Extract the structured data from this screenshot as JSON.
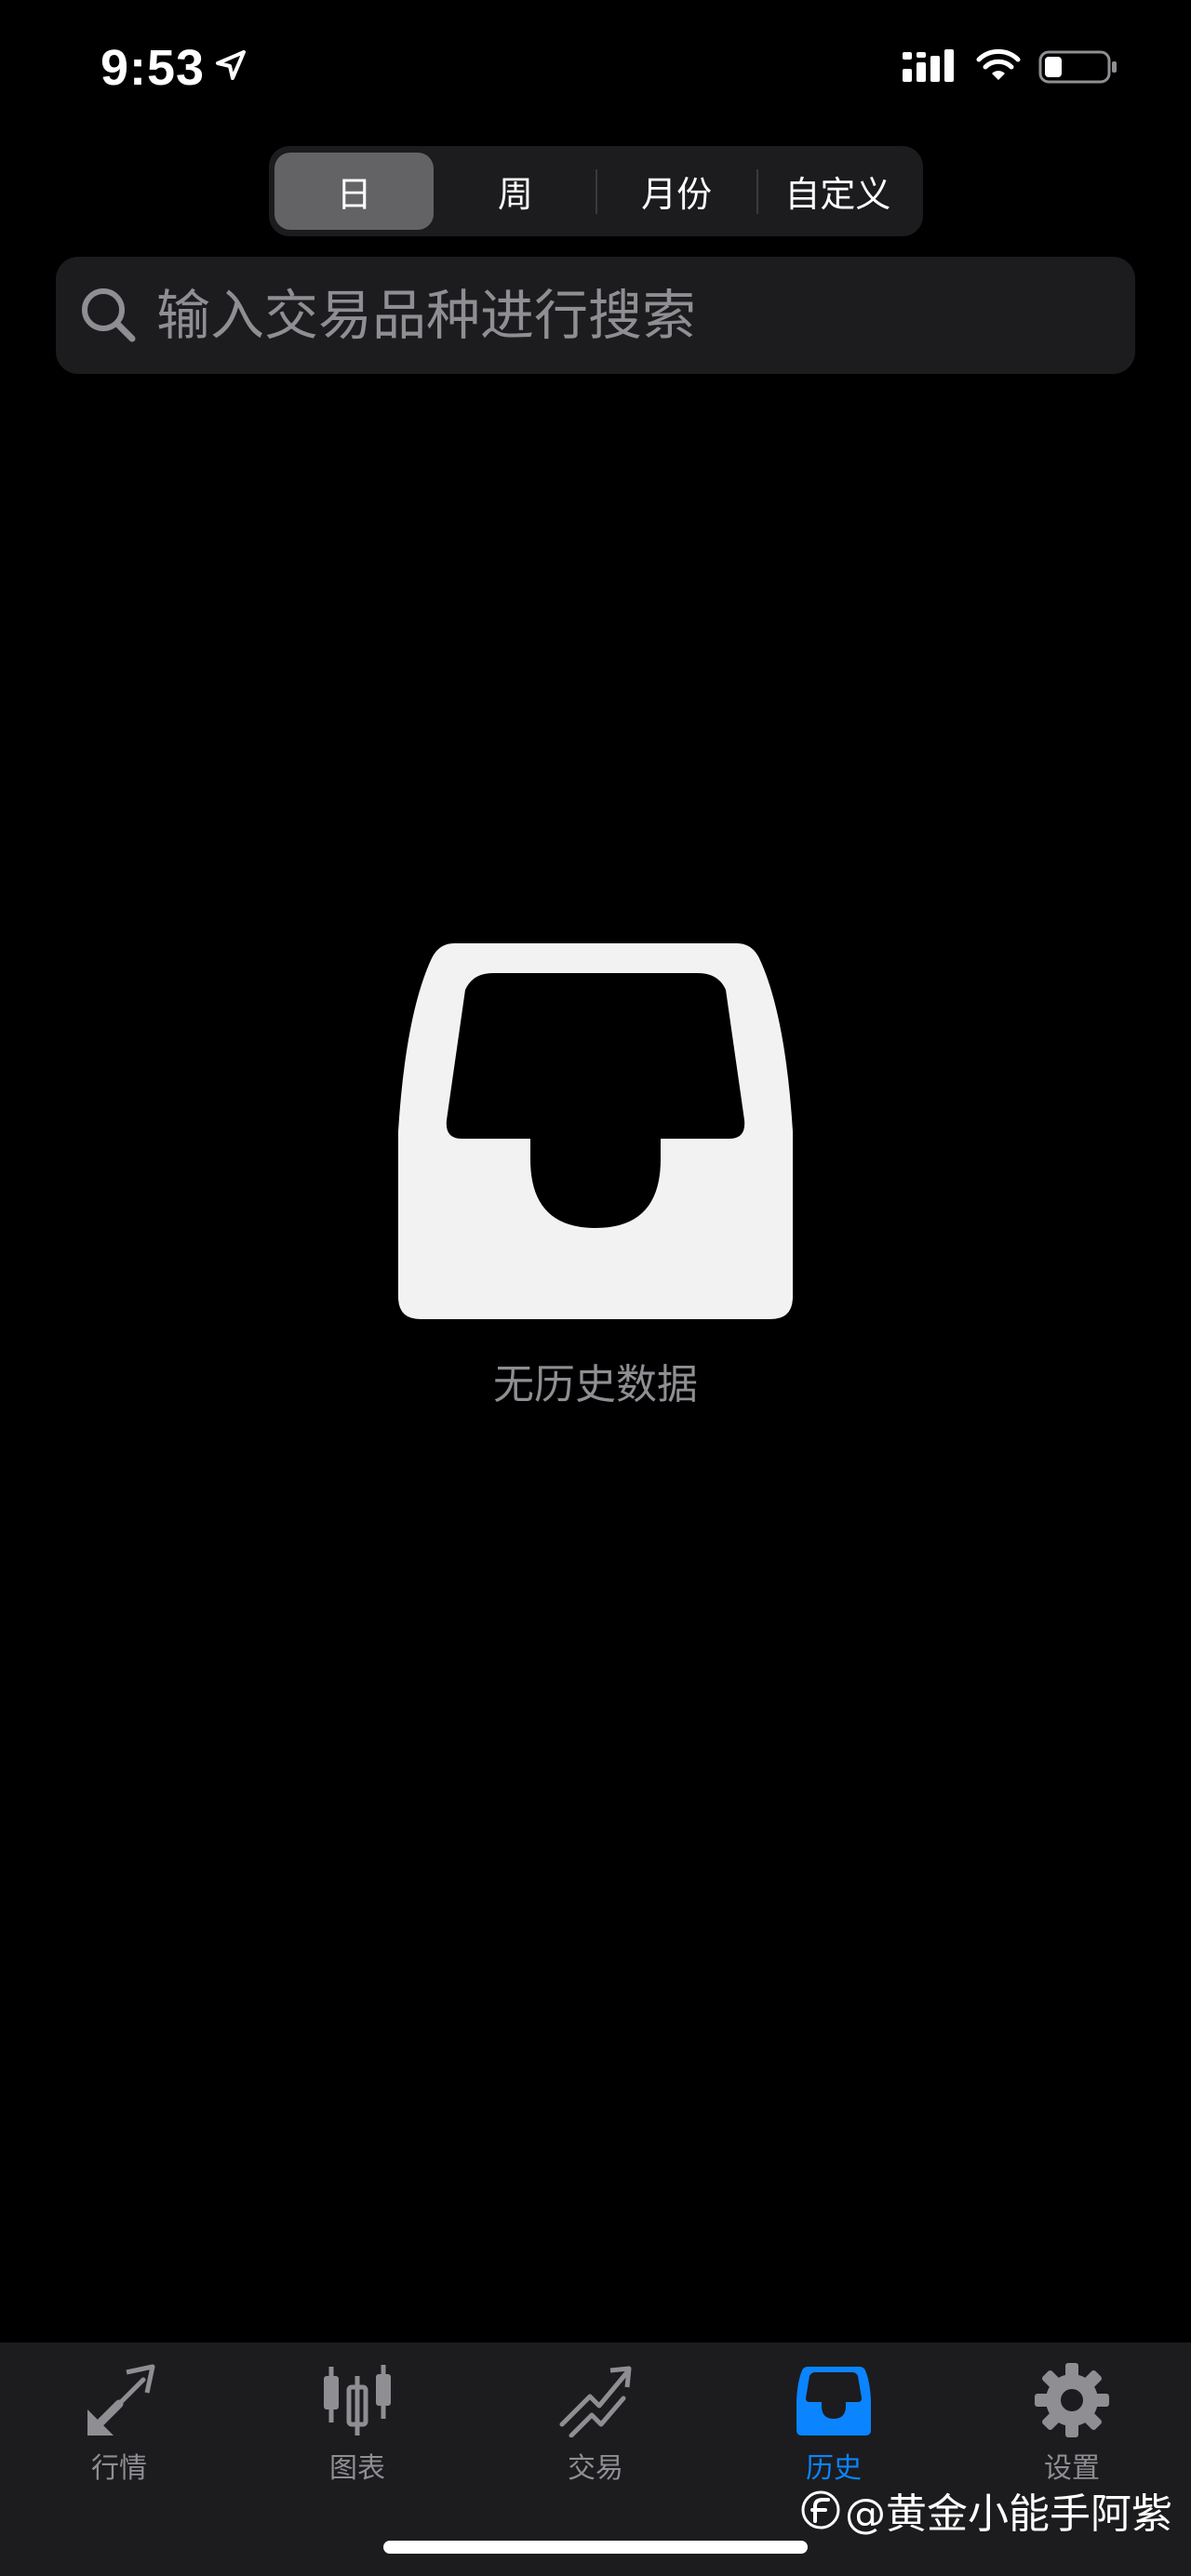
{
  "status_bar": {
    "time": "9:53",
    "icons": [
      "location-arrow-icon",
      "cellular-signal-icon",
      "wifi-icon",
      "battery-icon"
    ]
  },
  "segments": {
    "items": [
      {
        "label": "日",
        "active": true
      },
      {
        "label": "周",
        "active": false
      },
      {
        "label": "月份",
        "active": false
      },
      {
        "label": "自定义",
        "active": false
      }
    ]
  },
  "search": {
    "placeholder": "输入交易品种进行搜索",
    "value": ""
  },
  "empty_state": {
    "icon": "tray-icon",
    "text": "无历史数据"
  },
  "tab_bar": {
    "items": [
      {
        "label": "行情",
        "icon": "quotes-arrows-icon",
        "active": false
      },
      {
        "label": "图表",
        "icon": "candlestick-chart-icon",
        "active": false
      },
      {
        "label": "交易",
        "icon": "trade-trend-icon",
        "active": false
      },
      {
        "label": "历史",
        "icon": "history-tray-icon",
        "active": true
      },
      {
        "label": "设置",
        "icon": "gear-icon",
        "active": false
      }
    ]
  },
  "watermark": {
    "text": "@黄金小能手阿紫"
  },
  "colors": {
    "background": "#000000",
    "surface": "#1c1c1e",
    "segment_active": "#636366",
    "accent": "#0a84ff",
    "muted_text": "#8e8e93",
    "empty_icon": "#f2f2f2"
  }
}
